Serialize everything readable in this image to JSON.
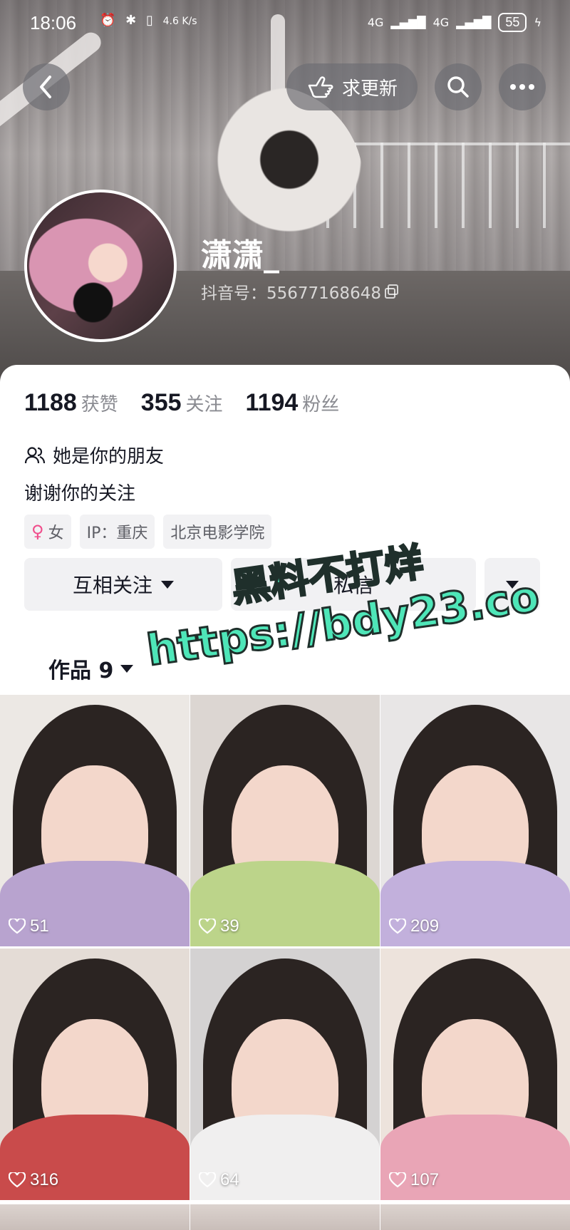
{
  "status_bar": {
    "time": "18:06",
    "net_speed": "4.6 K/s",
    "signal1": "4G",
    "signal2": "4G",
    "battery": "55"
  },
  "header": {
    "request_update_label": "求更新"
  },
  "profile": {
    "username": "潇潇_",
    "douyin_id": "抖音号：55677168648"
  },
  "stats": [
    {
      "num": "1188",
      "label": "获赞"
    },
    {
      "num": "355",
      "label": "关注"
    },
    {
      "num": "1194",
      "label": "粉丝"
    }
  ],
  "friend_text": "她是你的朋友",
  "bio": "谢谢你的关注",
  "tags": {
    "gender": "女",
    "ip": "IP：重庆",
    "school": "北京电影学院"
  },
  "actions": {
    "follow_label": "互相关注",
    "message_label": "私信"
  },
  "works_tab": {
    "label": "作品 9"
  },
  "videos": [
    {
      "likes": "51",
      "bg": "#ece8e4",
      "shirt": "#b8a3cf"
    },
    {
      "likes": "39",
      "bg": "#dcd6d2",
      "shirt": "#bcd48a"
    },
    {
      "likes": "209",
      "bg": "#e8e6e6",
      "shirt": "#c2b0dc"
    },
    {
      "likes": "316",
      "bg": "#e4dcd6",
      "shirt": "#c94b4b"
    },
    {
      "likes": "64",
      "bg": "#d4d2d2",
      "shirt": "#f0efef"
    },
    {
      "likes": "107",
      "bg": "#ede3dc",
      "shirt": "#e9a5b6"
    }
  ],
  "watermark": {
    "line1": "黑料不打烊",
    "line2": "https://bdy23.co"
  },
  "colors": {
    "watermark": "#4ee6b8",
    "gender_accent": "#f04d8b"
  }
}
